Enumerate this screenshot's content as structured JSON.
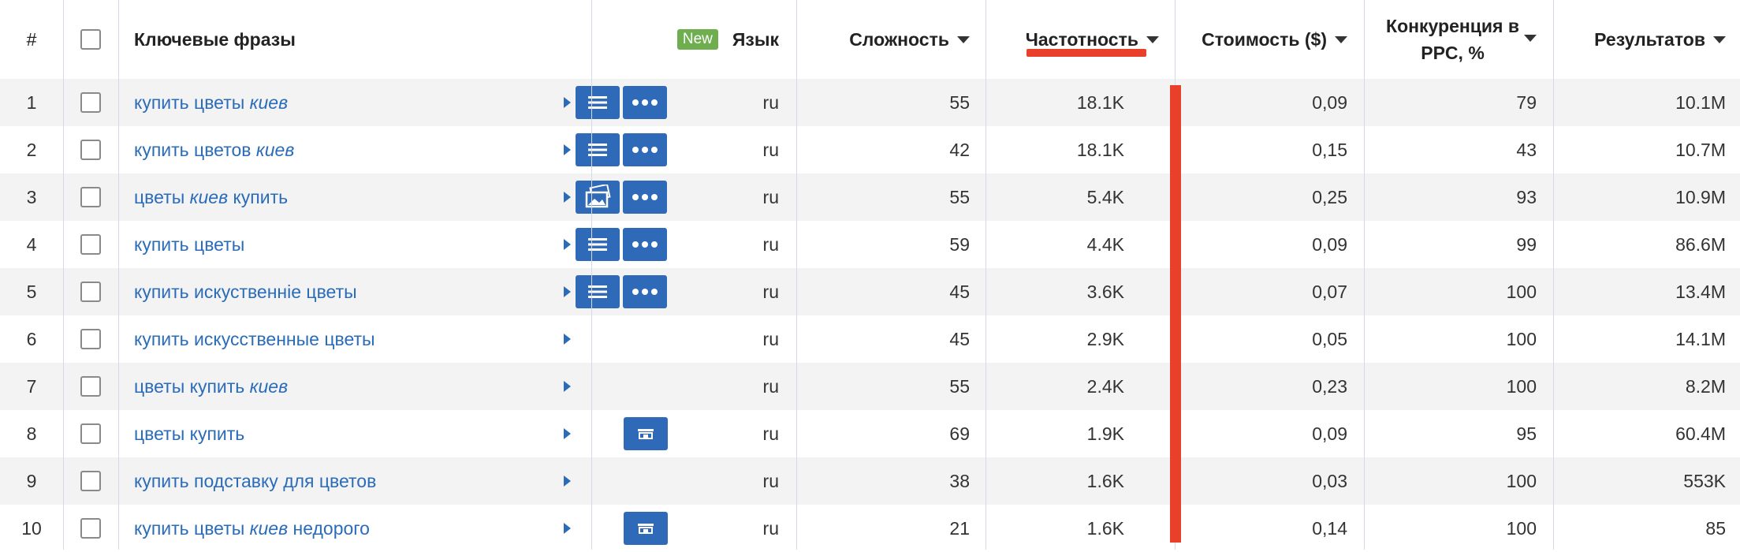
{
  "header": {
    "num": "#",
    "keywords": "Ключевые фразы",
    "new_badge": "New",
    "language": "Язык",
    "difficulty": "Сложность",
    "frequency": "Частотность",
    "cost": "Стоимость ($)",
    "competition_line1": "Конкуренция в",
    "competition_line2": "PPC, %",
    "results": "Результатов"
  },
  "accent": {
    "link": "#2b6cb8",
    "button": "#2f6ab8",
    "highlight": "#e8402a",
    "new": "#6eae4f"
  },
  "rows": [
    {
      "num": "1",
      "kw": [
        {
          "t": "купить цветы ",
          "i": false
        },
        {
          "t": "киев",
          "i": true
        }
      ],
      "actions": [
        "list-icon",
        "more-icon"
      ],
      "lang": "ru",
      "diff": "55",
      "freq": "18.1K",
      "cost": "0,09",
      "comp": "79",
      "res": "10.1M"
    },
    {
      "num": "2",
      "kw": [
        {
          "t": "купить цветов ",
          "i": false
        },
        {
          "t": "киев",
          "i": true
        }
      ],
      "actions": [
        "list-icon",
        "more-icon"
      ],
      "lang": "ru",
      "diff": "42",
      "freq": "18.1K",
      "cost": "0,15",
      "comp": "43",
      "res": "10.7M"
    },
    {
      "num": "3",
      "kw": [
        {
          "t": "цветы ",
          "i": false
        },
        {
          "t": "киев",
          "i": true
        },
        {
          "t": " купить",
          "i": false
        }
      ],
      "actions": [
        "images-icon",
        "more-icon"
      ],
      "lang": "ru",
      "diff": "55",
      "freq": "5.4K",
      "cost": "0,25",
      "comp": "93",
      "res": "10.9M"
    },
    {
      "num": "4",
      "kw": [
        {
          "t": "купить цветы",
          "i": false
        }
      ],
      "actions": [
        "list-icon",
        "more-icon"
      ],
      "lang": "ru",
      "diff": "59",
      "freq": "4.4K",
      "cost": "0,09",
      "comp": "99",
      "res": "86.6M"
    },
    {
      "num": "5",
      "kw": [
        {
          "t": "купить искуственніе цветы",
          "i": false
        }
      ],
      "actions": [
        "list-icon",
        "more-icon"
      ],
      "lang": "ru",
      "diff": "45",
      "freq": "3.6K",
      "cost": "0,07",
      "comp": "100",
      "res": "13.4M"
    },
    {
      "num": "6",
      "kw": [
        {
          "t": "купить искусственные цветы",
          "i": false
        }
      ],
      "actions": [],
      "lang": "ru",
      "diff": "45",
      "freq": "2.9K",
      "cost": "0,05",
      "comp": "100",
      "res": "14.1M"
    },
    {
      "num": "7",
      "kw": [
        {
          "t": "цветы купить ",
          "i": false
        },
        {
          "t": "киев",
          "i": true
        }
      ],
      "actions": [],
      "lang": "ru",
      "diff": "55",
      "freq": "2.4K",
      "cost": "0,23",
      "comp": "100",
      "res": "8.2M"
    },
    {
      "num": "8",
      "kw": [
        {
          "t": "цветы купить",
          "i": false
        }
      ],
      "actions": [
        "shop-icon"
      ],
      "lang": "ru",
      "diff": "69",
      "freq": "1.9K",
      "cost": "0,09",
      "comp": "95",
      "res": "60.4M"
    },
    {
      "num": "9",
      "kw": [
        {
          "t": "купить подставку для цветов",
          "i": false
        }
      ],
      "actions": [],
      "lang": "ru",
      "diff": "38",
      "freq": "1.6K",
      "cost": "0,03",
      "comp": "100",
      "res": "553K"
    },
    {
      "num": "10",
      "kw": [
        {
          "t": "купить цветы ",
          "i": false
        },
        {
          "t": "киев",
          "i": true
        },
        {
          "t": " недорого",
          "i": false
        }
      ],
      "actions": [
        "shop-icon"
      ],
      "lang": "ru",
      "diff": "21",
      "freq": "1.6K",
      "cost": "0,14",
      "comp": "100",
      "res": "85"
    }
  ]
}
